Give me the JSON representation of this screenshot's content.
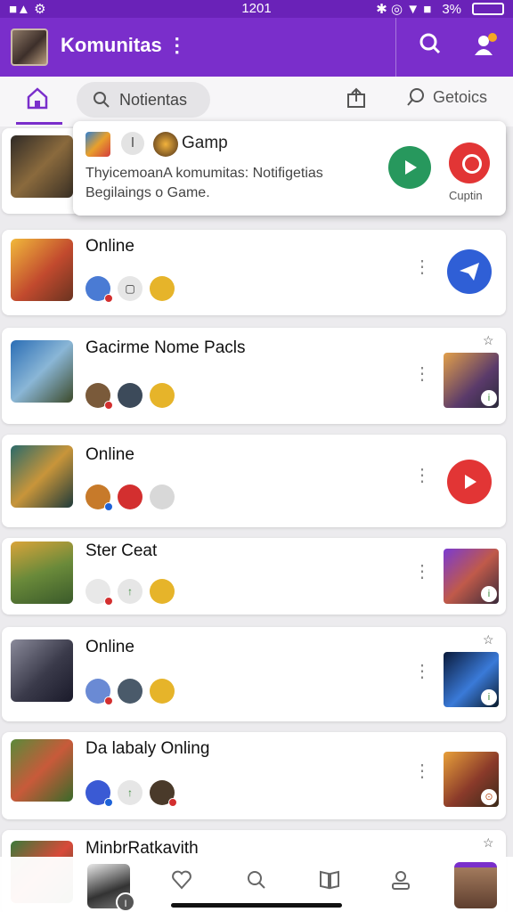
{
  "status": {
    "left_icons": "■▲ ⚙",
    "time": "1201",
    "right_icons": "✱ ◎ ▼ ■",
    "battery": "3%"
  },
  "appbar": {
    "title": "Komunitas ⋮"
  },
  "tabs": {
    "pill_label": "Notientas",
    "upload_icon": "upload-icon",
    "getoics_label": "Getoics"
  },
  "notification": {
    "title": "Gamp",
    "separator": "I",
    "body": "ThyicemoanA komumitas: Notifigetias Begilaings o Game.",
    "option_label": "Cuptin"
  },
  "cards": [
    {
      "title": "Online",
      "avatars": [
        {
          "text": "",
          "dot": "red"
        },
        {
          "text": "▢",
          "dot": ""
        },
        {
          "text": "",
          "dot": ""
        }
      ],
      "action": "send"
    },
    {
      "title": "Gacirme Nome Pacls",
      "avatars": [
        {
          "text": "",
          "dot": "red"
        },
        {
          "text": "",
          "dot": ""
        },
        {
          "text": "",
          "dot": ""
        }
      ],
      "action": "thumb"
    },
    {
      "title": "Online",
      "avatars": [
        {
          "text": "",
          "dot": "blue"
        },
        {
          "text": "",
          "dot": ""
        },
        {
          "text": "",
          "dot": ""
        }
      ],
      "action": "play"
    },
    {
      "title": "Ster Ceat",
      "avatars": [
        {
          "text": "",
          "dot": "red"
        },
        {
          "text": "↑",
          "dot": ""
        },
        {
          "text": "",
          "dot": ""
        }
      ],
      "action": "thumb"
    },
    {
      "title": "Online",
      "avatars": [
        {
          "text": "",
          "dot": "red"
        },
        {
          "text": "",
          "dot": ""
        },
        {
          "text": "",
          "dot": ""
        }
      ],
      "action": "thumb"
    },
    {
      "title": "Da labaly Onling",
      "avatars": [
        {
          "text": "",
          "dot": "blue"
        },
        {
          "text": "↑",
          "dot": ""
        },
        {
          "text": "",
          "dot": "red"
        }
      ],
      "action": "thumb"
    },
    {
      "title": "MinbrRatkavith",
      "avatars": [],
      "action": "thumb"
    }
  ],
  "bottomnav": {
    "avatar_badge": "I"
  },
  "colors": {
    "accent": "#7a2ecb",
    "play_green": "#27985d",
    "red": "#e23535",
    "blue_action": "#2f5fd6"
  }
}
